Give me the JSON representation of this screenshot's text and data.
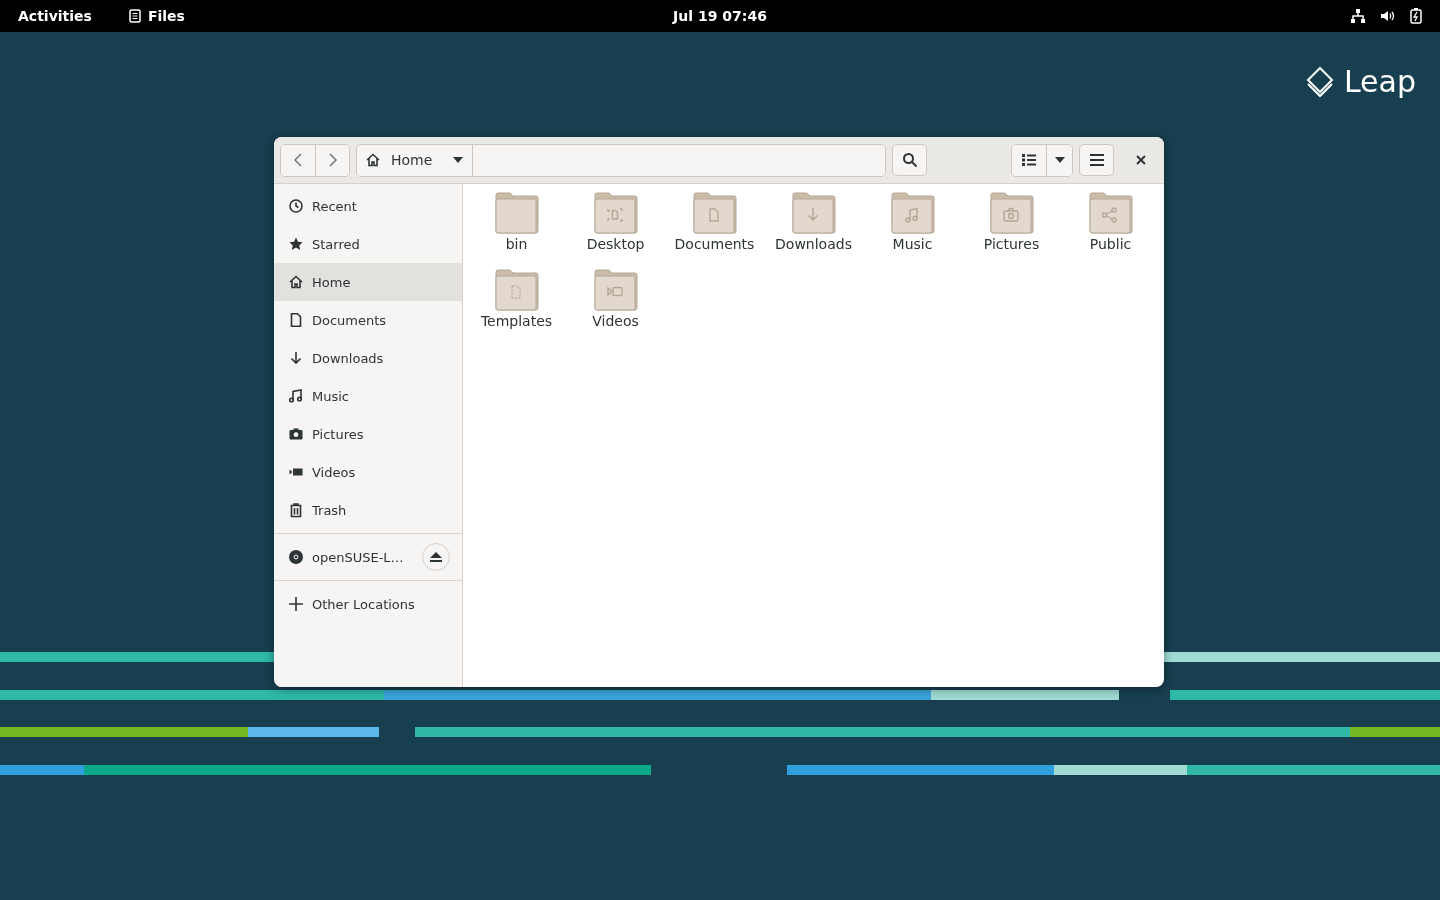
{
  "top_bar": {
    "activities": "Activities",
    "app_name": "Files",
    "clock": "Jul 19  07:46"
  },
  "logo": {
    "text": "Leap"
  },
  "window": {
    "path": {
      "label": "Home"
    },
    "sidebar": {
      "items": [
        {
          "label": "Recent",
          "kind": "clock",
          "selected": false
        },
        {
          "label": "Starred",
          "kind": "star",
          "selected": false
        },
        {
          "label": "Home",
          "kind": "home",
          "selected": true
        },
        {
          "label": "Documents",
          "kind": "document",
          "selected": false
        },
        {
          "label": "Downloads",
          "kind": "download",
          "selected": false
        },
        {
          "label": "Music",
          "kind": "music",
          "selected": false
        },
        {
          "label": "Pictures",
          "kind": "camera",
          "selected": false
        },
        {
          "label": "Videos",
          "kind": "video",
          "selected": false
        },
        {
          "label": "Trash",
          "kind": "trash",
          "selected": false
        }
      ],
      "devices": [
        {
          "label": "openSUSE-L…"
        }
      ],
      "other": {
        "label": "Other Locations"
      }
    },
    "files": [
      {
        "name": "bin",
        "kind": "plain"
      },
      {
        "name": "Desktop",
        "kind": "desktop"
      },
      {
        "name": "Documents",
        "kind": "document"
      },
      {
        "name": "Downloads",
        "kind": "download"
      },
      {
        "name": "Music",
        "kind": "music"
      },
      {
        "name": "Pictures",
        "kind": "camera"
      },
      {
        "name": "Public",
        "kind": "share"
      },
      {
        "name": "Templates",
        "kind": "template"
      },
      {
        "name": "Videos",
        "kind": "video"
      }
    ]
  }
}
